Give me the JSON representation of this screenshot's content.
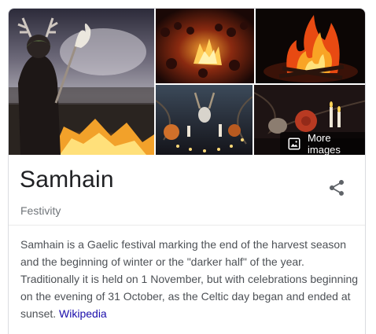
{
  "gallery": {
    "images": [
      {
        "name": "druid-with-torch",
        "alt": ""
      },
      {
        "name": "crowd-around-bonfire",
        "alt": ""
      },
      {
        "name": "campfire",
        "alt": ""
      },
      {
        "name": "altar-with-candles",
        "alt": ""
      },
      {
        "name": "candles-and-skulls",
        "alt": ""
      }
    ],
    "more_images_label": "More images",
    "more_images_icon": "image-icon"
  },
  "entity": {
    "title": "Samhain",
    "subtitle": "Festivity",
    "share_icon": "share-icon"
  },
  "description": {
    "text": "Samhain is a Gaelic festival marking the end of the harvest season and the beginning of winter or the \"darker half\" of the year. Traditionally it is held on 1 November, but with celebrations beginning on the evening of 31 October, as the Celtic day began and ended at sunset.",
    "source_label": "Wikipedia"
  },
  "colors": {
    "title": "#202124",
    "subtitle": "#70757a",
    "body_text": "#4d5156",
    "link": "#1a0dab",
    "share_icon": "#5f6368",
    "border": "#dadce0"
  }
}
